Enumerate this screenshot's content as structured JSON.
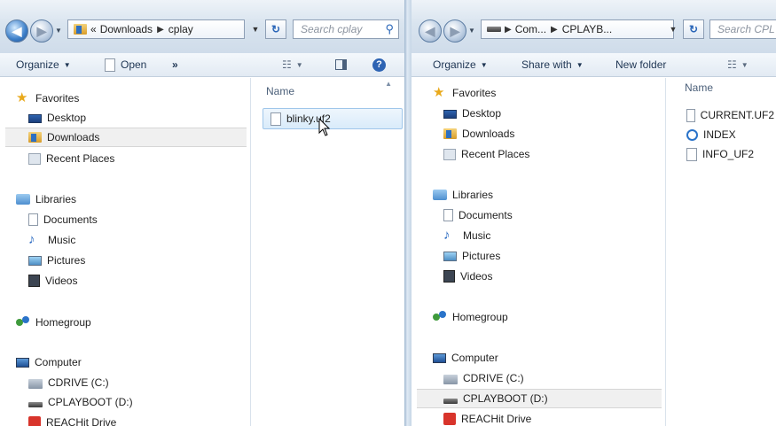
{
  "left_window": {
    "address": {
      "crumbs": [
        "«",
        "Downloads",
        "cplay"
      ]
    },
    "search_placeholder": "Search cplay",
    "toolbar": {
      "organize": "Organize",
      "open": "Open",
      "more": "»"
    },
    "nav": {
      "favorites": "Favorites",
      "favorites_items": [
        "Desktop",
        "Downloads",
        "Recent Places"
      ],
      "libraries": "Libraries",
      "libraries_items": [
        "Documents",
        "Music",
        "Pictures",
        "Videos"
      ],
      "homegroup": "Homegroup",
      "computer": "Computer",
      "computer_items": [
        "CDRIVE (C:)",
        "CPLAYBOOT (D:)",
        "REACHit Drive"
      ]
    },
    "column_name": "Name",
    "files": [
      "blinky.uf2"
    ]
  },
  "right_window": {
    "address": {
      "crumbs": [
        "Com...",
        "CPLAYB..."
      ]
    },
    "search_placeholder": "Search CPL",
    "toolbar": {
      "organize": "Organize",
      "share_with": "Share with",
      "new_folder": "New folder"
    },
    "nav": {
      "favorites": "Favorites",
      "favorites_items": [
        "Desktop",
        "Downloads",
        "Recent Places"
      ],
      "libraries": "Libraries",
      "libraries_items": [
        "Documents",
        "Music",
        "Pictures",
        "Videos"
      ],
      "homegroup": "Homegroup",
      "computer": "Computer",
      "computer_items": [
        "CDRIVE (C:)",
        "CPLAYBOOT (D:)",
        "REACHit Drive"
      ]
    },
    "column_name": "Name",
    "files": [
      "CURRENT.UF2",
      "INDEX",
      "INFO_UF2"
    ]
  }
}
